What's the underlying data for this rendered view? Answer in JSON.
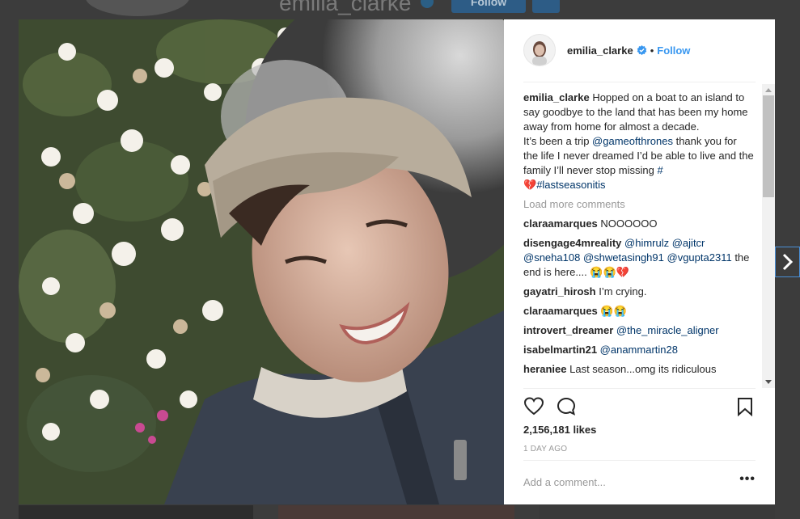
{
  "background": {
    "profile_username": "emilia_clarke",
    "follow_label": "Follow",
    "more_icon": "ellipsis-icon"
  },
  "post": {
    "username": "emilia_clarke",
    "verified": true,
    "follow_label": "Follow",
    "caption": {
      "username": "emilia_clarke",
      "text_1": "Hopped on a boat to an island to say goodbye to the land that has been my home away from home for almost a decade.",
      "text_2": "It’s been a trip ",
      "mention": "@gameofthrones",
      "text_3": " thank you for the life I never dreamed I’d be able to live and the family I’ll never stop missing ",
      "hashtag_1": "#",
      "emoji": "💔",
      "hashtag_2": "#lastseasonitis"
    },
    "load_more": "Load more comments",
    "comments": [
      {
        "username": "claraamarques",
        "text": "NOOOOOO"
      },
      {
        "username": "disengage4mreality",
        "mentions": [
          "@himrulz",
          "@ajitcr",
          "@sneha108",
          "@shwetasingh91",
          "@vgupta2311"
        ],
        "text": "the end is here.... 😭😭💔"
      },
      {
        "username": "gayatri_hirosh",
        "text": "I’m crying."
      },
      {
        "username": "claraamarques",
        "text": "😭😭"
      },
      {
        "username": "introvert_dreamer",
        "mention": "@the_miracle_aligner"
      },
      {
        "username": "isabelmartin21",
        "mention": "@anammartin28"
      },
      {
        "username": "heraniee",
        "text": "Last season...omg its ridiculous"
      }
    ],
    "likes": "2,156,181 likes",
    "time_ago": "1 DAY AGO",
    "add_comment_placeholder": "Add a comment...",
    "more_options": "•••"
  },
  "colors": {
    "link": "#003569",
    "follow": "#3897f0",
    "muted": "#999999"
  },
  "icons": {
    "like": "heart-icon",
    "comment": "comment-bubble-icon",
    "save": "bookmark-icon",
    "verified": "verified-badge-icon",
    "next": "chevron-right-icon"
  }
}
